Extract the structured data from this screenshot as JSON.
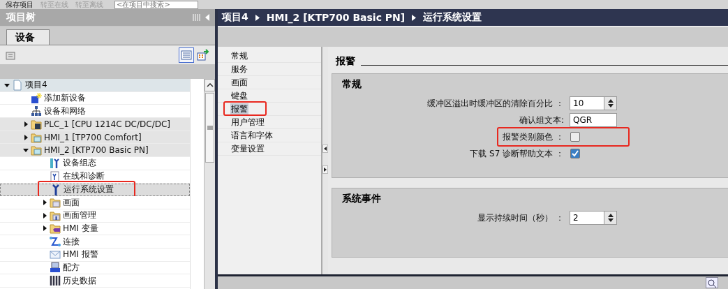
{
  "toolbar": {
    "actions": [
      {
        "label": "保存项目",
        "disabled": false
      },
      {
        "label": "转至在线",
        "disabled": true
      },
      {
        "label": "转至离线",
        "disabled": true
      }
    ],
    "search": {
      "placeholder": "<在项目中搜索>"
    }
  },
  "project_tree": {
    "title": "项目树",
    "tabs": [
      {
        "label": "设备",
        "selected": true
      }
    ],
    "items": [
      {
        "label": "项目4",
        "kind": "project",
        "expanded": true,
        "selected": false,
        "children": [
          {
            "label": "添加新设备",
            "kind": "add-device",
            "selected": false
          },
          {
            "label": "设备和网络",
            "kind": "network",
            "selected": false
          },
          {
            "label": "PLC_1 [CPU 1214C DC/DC/DC]",
            "kind": "plc",
            "expanded": false,
            "selected": false
          },
          {
            "label": "HMI_1 [TP700 Comfort]",
            "kind": "hmi",
            "expanded": false,
            "selected": false
          },
          {
            "label": "HMI_2 [KTP700 Basic PN]",
            "kind": "hmi",
            "expanded": true,
            "selected": false,
            "children": [
              {
                "label": "设备组态",
                "kind": "config",
                "selected": false
              },
              {
                "label": "在线和诊断",
                "kind": "diagnostics",
                "selected": false
              },
              {
                "label": "运行系统设置",
                "kind": "runtime",
                "selected": true,
                "highlighted": true
              },
              {
                "label": "画面",
                "kind": "folder",
                "expanded": false,
                "selected": false
              },
              {
                "label": "画面管理",
                "kind": "folder-tool",
                "expanded": false,
                "selected": false
              },
              {
                "label": "HMI 变量",
                "kind": "folder-tag",
                "expanded": false,
                "selected": false
              },
              {
                "label": "连接",
                "kind": "connection",
                "selected": false
              },
              {
                "label": "HMI 报警",
                "kind": "alarm",
                "selected": false
              },
              {
                "label": "配方",
                "kind": "recipe",
                "selected": false
              },
              {
                "label": "历史数据",
                "kind": "history",
                "selected": false
              }
            ]
          }
        ]
      }
    ]
  },
  "breadcrumb": [
    "项目4",
    "HMI_2 [KTP700 Basic PN]",
    "运行系统设置"
  ],
  "nav": [
    {
      "label": "常规",
      "selected": false,
      "highlighted": false
    },
    {
      "label": "服务",
      "selected": false,
      "highlighted": false
    },
    {
      "label": "画面",
      "selected": false,
      "highlighted": false
    },
    {
      "label": "键盘",
      "selected": false,
      "highlighted": false
    },
    {
      "label": "报警",
      "selected": true,
      "highlighted": true
    },
    {
      "label": "用户管理",
      "selected": false,
      "highlighted": false
    },
    {
      "label": "语言和字体",
      "selected": false,
      "highlighted": false
    },
    {
      "label": "变量设置",
      "selected": false,
      "highlighted": false
    }
  ],
  "settings": {
    "heading": "报警",
    "sections": [
      {
        "title": "常规",
        "rows": [
          {
            "kind": "spinner",
            "label": "缓冲区溢出时缓冲区的清除百分比 ：",
            "value": "10"
          },
          {
            "kind": "text",
            "label": "确认组文本:",
            "value": "QGR"
          },
          {
            "kind": "checkbox",
            "label": "报警类别颜色 ：",
            "checked": false,
            "highlighted": true
          },
          {
            "kind": "checkbox",
            "label": "下载 S7 诊断帮助文本 ：",
            "checked": true
          }
        ]
      },
      {
        "title": "系统事件",
        "rows": [
          {
            "kind": "spinner",
            "label": "显示持续时间（秒） ：",
            "value": "2"
          }
        ]
      }
    ]
  }
}
